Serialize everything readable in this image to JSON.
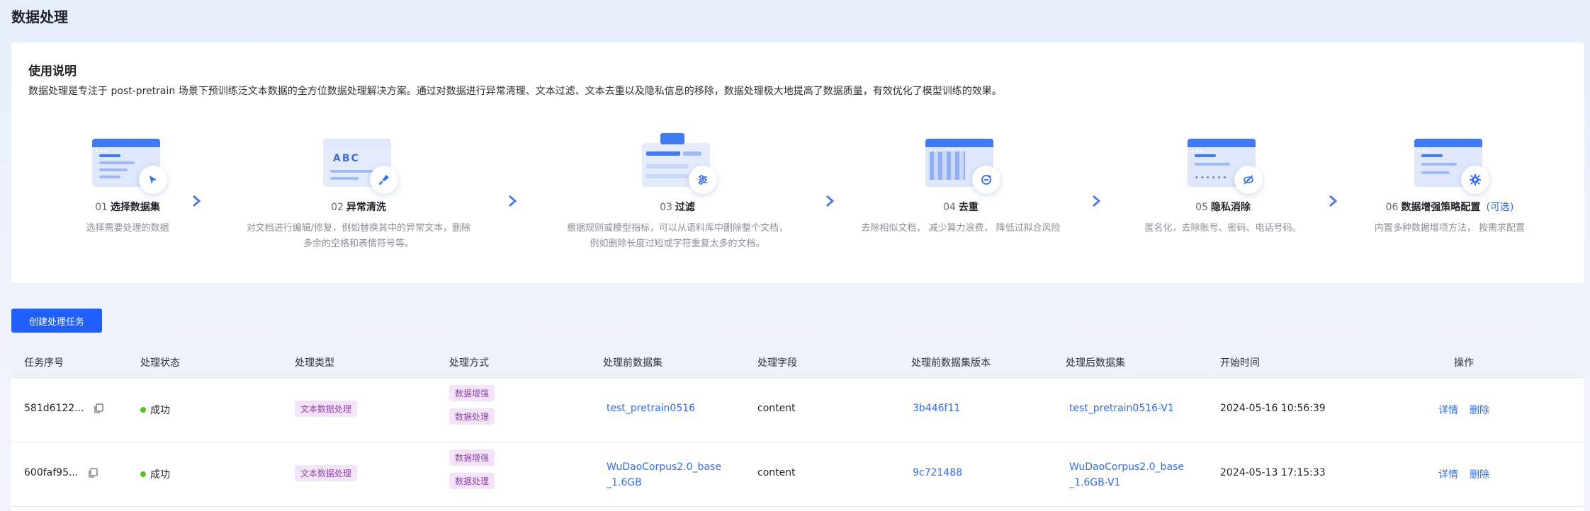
{
  "page": {
    "title": "数据处理"
  },
  "guide": {
    "title": "使用说明",
    "description": "数据处理是专注于 post-pretrain 场景下预训练泛文本数据的全方位数据处理解决方案。通过对数据进行异常清理、文本过滤、文本去重以及隐私信息的移除，数据处理极大地提高了数据质量，有效优化了模型训练的效果。",
    "steps": [
      {
        "num": "01",
        "name": "选择数据集",
        "optional": "",
        "desc_lines": [
          "选择需要处理的数据"
        ],
        "icon": "cursor-icon"
      },
      {
        "num": "02",
        "name": "异常清洗",
        "optional": "",
        "desc_lines": [
          "对文档进行编辑/修复，例如替换其中的异常文本，删除",
          "多余的空格和表情符号等。"
        ],
        "icon": "brush-icon",
        "abc": "ABC"
      },
      {
        "num": "03",
        "name": "过滤",
        "optional": "",
        "desc_lines": [
          "根据规则或模型指标，可以从语料库中删除整个文档，",
          "例如删除长度过短或字符重复太多的文档。"
        ],
        "icon": "sliders-icon"
      },
      {
        "num": "04",
        "name": "去重",
        "optional": "",
        "desc_lines": [
          "去除相似文档， 减少算力浪费， 降低过拟合风险"
        ],
        "icon": "dedupe-icon"
      },
      {
        "num": "05",
        "name": "隐私消除",
        "optional": "",
        "desc_lines": [
          "匿名化，去除账号、密码、电话号码。"
        ],
        "icon": "eye-off-icon"
      },
      {
        "num": "06",
        "name": "数据增强策略配置",
        "optional": "(可选)",
        "desc_lines": [
          "内置多种数据增项方法， 按需求配置"
        ],
        "icon": "gear-icon"
      }
    ]
  },
  "toolbar": {
    "create_label": "创建处理任务"
  },
  "table": {
    "headers": {
      "id": "任务序号",
      "status": "处理状态",
      "type": "处理类型",
      "method": "处理方式",
      "src": "处理前数据集",
      "field": "处理字段",
      "version": "处理前数据集版本",
      "dst": "处理后数据集",
      "time": "开始时间",
      "ops": "操作"
    },
    "rows": [
      {
        "id": "581d6122...",
        "status": "成功",
        "type": "文本数据处理",
        "methods": [
          "数据增强",
          "数据处理"
        ],
        "src": [
          "test_pretrain0516",
          ""
        ],
        "field": "content",
        "version": "3b446f11",
        "dst": [
          "test_pretrain0516-V1",
          ""
        ],
        "time": "2024-05-16 10:56:39",
        "detail": "详情",
        "delete": "删除"
      },
      {
        "id": "600faf95...",
        "status": "成功",
        "type": "文本数据处理",
        "methods": [
          "数据增强",
          "数据处理"
        ],
        "src": [
          "WuDaoCorpus2.0_base",
          "_1.6GB"
        ],
        "field": "content",
        "version": "9c721488",
        "dst": [
          "WuDaoCorpus2.0_base",
          "_1.6GB-V1"
        ],
        "time": "2024-05-13 17:15:33",
        "detail": "详情",
        "delete": "删除"
      }
    ]
  },
  "colors": {
    "primary": "#1f5eff",
    "link": "#2f6bff",
    "success": "#52c41a",
    "tag_bg": "#f3e4f9",
    "tag_text": "#8e44ad"
  }
}
